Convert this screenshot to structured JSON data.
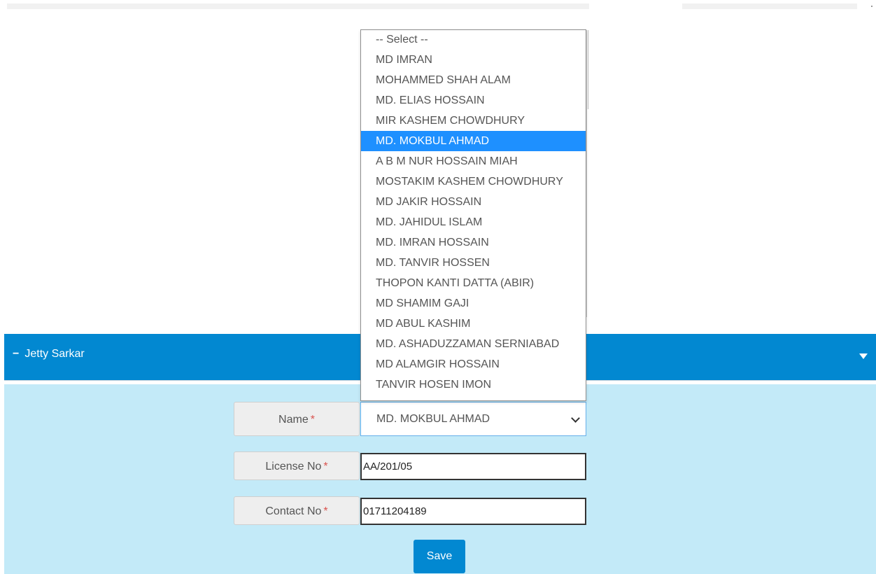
{
  "panel": {
    "title": "Jetty Sarkar",
    "collapse_symbol": "−"
  },
  "form": {
    "name_label": "Name",
    "license_label": "License No",
    "contact_label": "Contact No",
    "required_mark": "*",
    "name_selected": "MD. MOKBUL AHMAD",
    "license_value": "AA/201/05",
    "contact_value": "01711204189",
    "save_label": "Save"
  },
  "dropdown": {
    "options": [
      "-- Select --",
      "MD IMRAN",
      "MOHAMMED SHAH ALAM",
      "MD. ELIAS HOSSAIN",
      "MIR KASHEM CHOWDHURY",
      "MD. MOKBUL AHMAD",
      "A B M NUR HOSSAIN MIAH",
      "MOSTAKIM KASHEM CHOWDHURY",
      "MD JAKIR HOSSAIN",
      "MD. JAHIDUL ISLAM",
      "MD. IMRAN HOSSAIN",
      "MD. TANVIR HOSSEN",
      "THOPON KANTI DATTA (ABIR)",
      "MD SHAMIM GAJI",
      "MD ABUL KASHIM",
      "MD. ASHADUZZAMAN SERNIABAD",
      "MD ALAMGIR HOSSAIN",
      "TANVIR HOSEN IMON"
    ],
    "highlighted": "MD. MOKBUL AHMAD"
  },
  "colors": {
    "header_bg": "#0288d1",
    "body_bg": "#c3eaf8",
    "highlight": "#1e90ff",
    "required": "#d9534f"
  },
  "icons": {
    "panel_toggle": "caret-down-icon",
    "select_arrow": "chevron-down-icon"
  }
}
